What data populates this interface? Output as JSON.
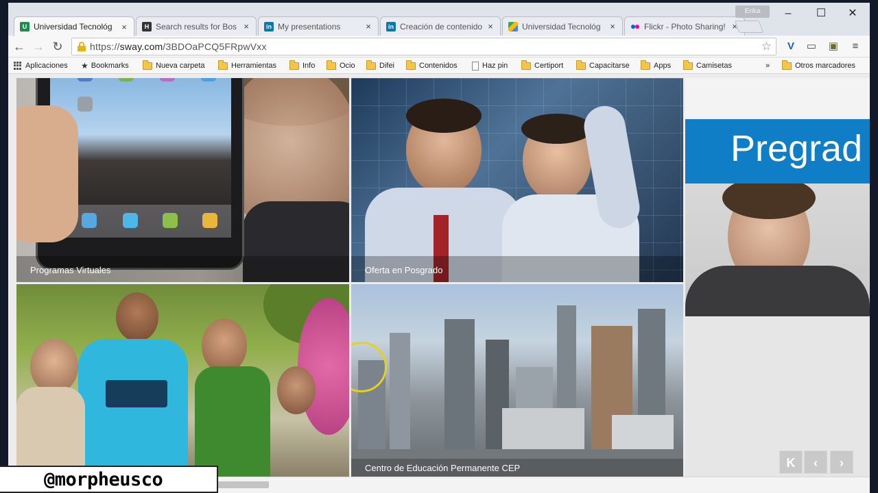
{
  "browser": {
    "tabs": [
      {
        "title": "Universidad Tecnológ",
        "favicon": "utp-favicon",
        "active": true
      },
      {
        "title": "Search results for Bos",
        "favicon": "haiku-deck-favicon",
        "active": false
      },
      {
        "title": "My presentations",
        "favicon": "linkedin-favicon",
        "active": false
      },
      {
        "title": "Creación de contenido",
        "favicon": "linkedin-favicon",
        "active": false
      },
      {
        "title": "Universidad Tecnológ",
        "favicon": "google-drive-favicon",
        "active": false
      },
      {
        "title": "Flickr - Photo Sharing!",
        "favicon": "flickr-favicon",
        "active": false
      }
    ],
    "user_badge": "Erika",
    "window_controls": {
      "minimize": "–",
      "maximize": "☐",
      "close": "✕"
    },
    "address": {
      "scheme": "https://",
      "domain": "sway.com",
      "path": "/3BDOaPCQ5FRpwVxx"
    },
    "bookmarks": [
      {
        "label": "Aplicaciones",
        "icon": "apps-grid-icon"
      },
      {
        "label": "Bookmarks",
        "icon": "star-icon"
      },
      {
        "label": "Nueva carpeta",
        "icon": "folder-icon"
      },
      {
        "label": "Herramientas",
        "icon": "folder-icon"
      },
      {
        "label": "Info",
        "icon": "folder-icon"
      },
      {
        "label": "Ocio",
        "icon": "folder-icon"
      },
      {
        "label": "Difei",
        "icon": "folder-icon"
      },
      {
        "label": "Contenidos",
        "icon": "folder-icon"
      },
      {
        "label": "Haz pin",
        "icon": "page-icon"
      },
      {
        "label": "Certiport",
        "icon": "folder-icon"
      },
      {
        "label": "Capacitarse",
        "icon": "folder-icon"
      },
      {
        "label": "Apps",
        "icon": "folder-icon"
      },
      {
        "label": "Camisetas",
        "icon": "folder-icon"
      }
    ],
    "bookmarks_overflow": "»",
    "other_bookmarks": "Otros marcadores"
  },
  "sway": {
    "tiles": [
      {
        "caption": "Programas Virtuales"
      },
      {
        "caption": "Oferta en Posgrado"
      },
      {
        "caption": ""
      },
      {
        "caption": "Centro de Educación Permanente CEP"
      }
    ],
    "side_card": {
      "heading": "Pregrad"
    },
    "nav": {
      "first": "K",
      "prev": "‹",
      "next": "›"
    }
  },
  "watermark": "@morpheusco",
  "colors": {
    "sway_blue": "#0f7ec6",
    "cursor_ring": "#e5d21c"
  }
}
